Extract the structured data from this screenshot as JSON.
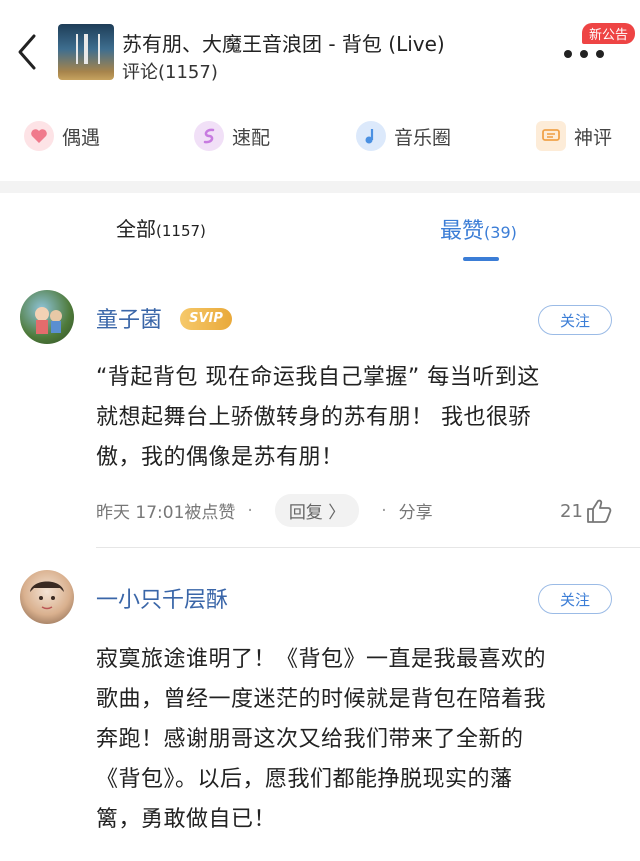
{
  "header": {
    "title": "苏有朋、大魔王音浪团 - 背包 (Live)",
    "subtitle": "评论(1157)",
    "badge": "新公告",
    "back_icon": "chevron-left-icon",
    "more_icon": "more-dots-icon"
  },
  "quick_actions": [
    {
      "label": "偶遇",
      "icon": "heart-icon",
      "color": "#f07a8c"
    },
    {
      "label": "速配",
      "icon": "swirl-icon",
      "color": "#c77be0"
    },
    {
      "label": "音乐圈",
      "icon": "music-note-icon",
      "color": "#4a90e2"
    },
    {
      "label": "神评",
      "icon": "comment-icon",
      "color": "#f0a24a"
    }
  ],
  "tabs": [
    {
      "label": "全部",
      "count": "(1157)"
    },
    {
      "label": "最赞",
      "count": "(39)"
    }
  ],
  "comments": [
    {
      "username": "童子菌",
      "vip": "SVIP",
      "follow": "关注",
      "lines": [
        "“背起背包 现在命运我自己掌握” 每当听到这",
        "就想起舞台上骄傲转身的苏有朋！ 我也很骄",
        "傲，我的偶像是苏有朋！"
      ],
      "time": "昨天 17:01被点赞",
      "reply": "回复 〉",
      "share": "分享",
      "likes": "21"
    },
    {
      "username": "一小只千层酥",
      "follow": "关注",
      "lines": [
        "寂寞旅途谁明了！《背包》一直是我最喜欢的",
        "歌曲，曾经一度迷茫的时候就是背包在陪着我",
        "奔跑！感谢朋哥这次又给我们带来了全新的",
        "《背包》。以后，愿我们都能挣脱现实的藩",
        "篱，勇敢做自已！"
      ]
    }
  ],
  "colors": {
    "accent": "#3b7dd6",
    "username": "#3a66a8",
    "badge": "#ee4444"
  }
}
